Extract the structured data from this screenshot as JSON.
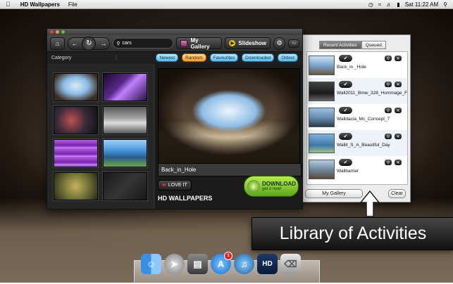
{
  "menubar": {
    "app_name": "HD Wallpapers",
    "menus": [
      "File"
    ],
    "clock": "Sat 11:22 AM"
  },
  "main_window": {
    "toolbar": {
      "search_value": "cars",
      "my_gallery_label": "My Gallery",
      "slideshow_label": "Slideshow"
    },
    "category_label": "Category",
    "filters": [
      "Newest",
      "Random",
      "Favourites",
      "Downloaded",
      "Oldest"
    ],
    "active_filter": "Random",
    "preview_title": "Back_in_Hole",
    "love_it_label": "LOVE IT",
    "brand_label": "HD WALLPAPERS",
    "download_label": "DOWNLOAD",
    "download_sub": "get it now!",
    "thumbnails": [
      {
        "name": "thumb-cave",
        "color": "#9cc3e6"
      },
      {
        "name": "thumb-purple-streaks",
        "color": "#5a2a8a"
      },
      {
        "name": "thumb-dark-abstract",
        "color": "#3a2a3a"
      },
      {
        "name": "thumb-car",
        "color": "#8a8a8a"
      },
      {
        "name": "thumb-purple-waves",
        "color": "#a040d0"
      },
      {
        "name": "thumb-blue-sky",
        "color": "#3b8ad0"
      },
      {
        "name": "thumb-frog",
        "color": "#8a7a4a"
      },
      {
        "name": "thumb-dark",
        "color": "#202020"
      }
    ]
  },
  "activities_panel": {
    "tabs": [
      "Recent Activities",
      "Queued"
    ],
    "selected_tab": "Recent Activities",
    "items": [
      {
        "name": "Back_in _Hole",
        "color": "#7aa7cf"
      },
      {
        "name": "Wall2011_Bmw_328_Hommage_F",
        "color": "#2a2a2a"
      },
      {
        "name": "Walldacia_Mc_Concept_7",
        "color": "#6a8fb5"
      },
      {
        "name": "Wallit_S_A_Beautiful_Day",
        "color": "#3f78a8"
      },
      {
        "name": "Wallbarrier",
        "color": "#6f8aa0"
      }
    ],
    "my_gallery_label": "My Gallery",
    "clear_label": "Clear"
  },
  "callout": {
    "text": "Library of Activities"
  },
  "dock": {
    "badge_count": "1",
    "items": [
      "finder",
      "rocket",
      "preview",
      "app-store",
      "itunes",
      "hd-wallpapers",
      "trash"
    ]
  }
}
